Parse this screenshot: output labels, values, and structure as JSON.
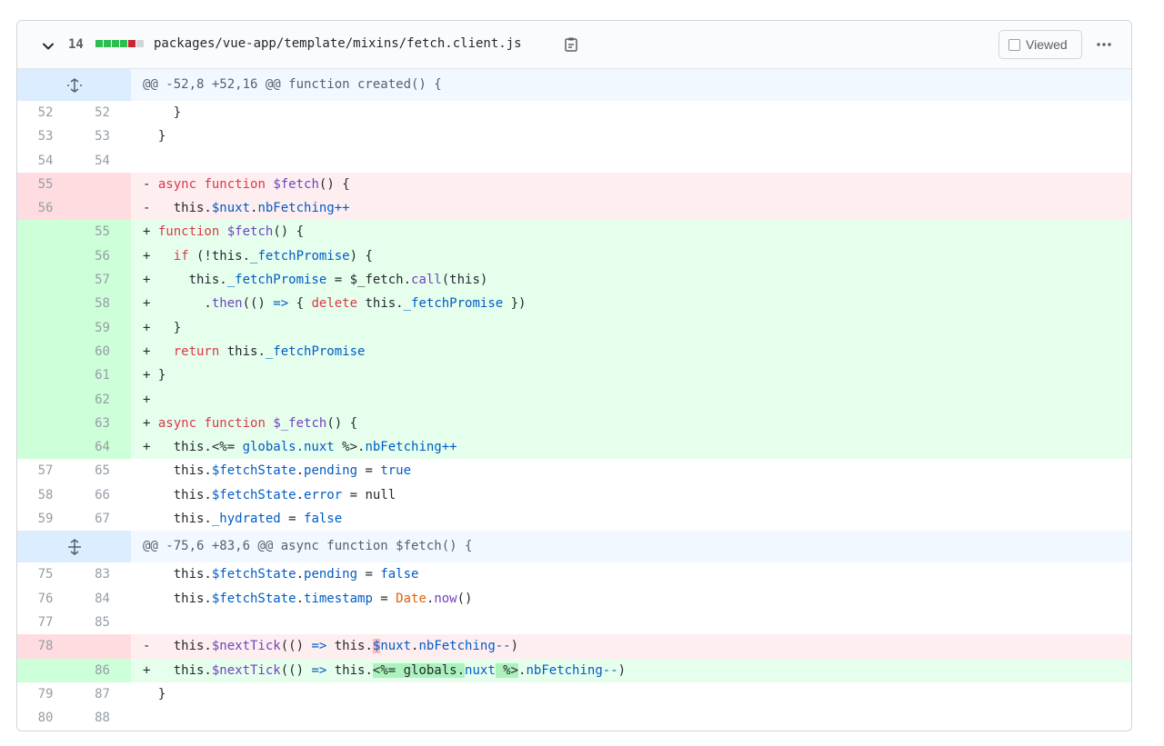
{
  "file": {
    "changes": "14",
    "path": "packages/vue-app/template/mixins/fetch.client.js",
    "viewed_label": "Viewed",
    "bar_colors": [
      "#2cbe4e",
      "#2cbe4e",
      "#2cbe4e",
      "#2cbe4e",
      "#cb2431",
      "#d1d5da"
    ]
  },
  "hunks": [
    {
      "header": "@@ -52,8 +52,16 @@ function created() {"
    },
    {
      "header": "@@ -75,6 +83,6 @@ async function $fetch() {"
    }
  ],
  "line_numbers": {
    "r1": [
      "52",
      "52"
    ],
    "r2": [
      "53",
      "53"
    ],
    "r3": [
      "54",
      "54"
    ],
    "r4": [
      "55",
      ""
    ],
    "r5": [
      "56",
      ""
    ],
    "r6": [
      "",
      "55"
    ],
    "r7": [
      "",
      "56"
    ],
    "r8": [
      "",
      "57"
    ],
    "r9": [
      "",
      "58"
    ],
    "r10": [
      "",
      "59"
    ],
    "r11": [
      "",
      "60"
    ],
    "r12": [
      "",
      "61"
    ],
    "r13": [
      "",
      "62"
    ],
    "r14": [
      "",
      "63"
    ],
    "r15": [
      "",
      "64"
    ],
    "r16": [
      "57",
      "65"
    ],
    "r17": [
      "58",
      "66"
    ],
    "r18": [
      "59",
      "67"
    ],
    "r19": [
      "75",
      "83"
    ],
    "r20": [
      "76",
      "84"
    ],
    "r21": [
      "77",
      "85"
    ],
    "r22": [
      "78",
      ""
    ],
    "r23": [
      "",
      "86"
    ],
    "r24": [
      "79",
      "87"
    ],
    "r25": [
      "80",
      "88"
    ]
  },
  "code": {
    "r1": [
      "    }"
    ],
    "r2": [
      "  }"
    ],
    "r3": [
      ""
    ],
    "r4": [
      "- ",
      "async",
      " ",
      "function",
      " ",
      "$fetch",
      "() {"
    ],
    "r5": [
      "-   this.",
      "$nuxt",
      ".",
      "nbFetching++"
    ],
    "r6": [
      "+ ",
      "function",
      " ",
      "$fetch",
      "() {"
    ],
    "r7": [
      "+   ",
      "if",
      " (!this.",
      "_fetchPromise",
      ") {"
    ],
    "r8": [
      "+     this.",
      "_fetchPromise",
      " = $_fetch.",
      "call",
      "(this)"
    ],
    "r9": [
      "+       .",
      "then",
      "(() ",
      "=>",
      " { ",
      "delete",
      " this.",
      "_fetchPromise",
      " })"
    ],
    "r10": [
      "+   }"
    ],
    "r11": [
      "+   ",
      "return",
      " this.",
      "_fetchPromise"
    ],
    "r12": [
      "+ }"
    ],
    "r13": [
      "+"
    ],
    "r14": [
      "+ ",
      "async",
      " ",
      "function",
      " ",
      "$_fetch",
      "() {"
    ],
    "r15": [
      "+   this.<%= ",
      "globals.nuxt",
      " %>.",
      "nbFetching++"
    ],
    "r16": [
      "    this.",
      "$fetchState",
      ".",
      "pending",
      " = ",
      "true"
    ],
    "r17": [
      "    this.",
      "$fetchState",
      ".",
      "error",
      " = null"
    ],
    "r18": [
      "    this.",
      "_hydrated",
      " = ",
      "false"
    ],
    "r19": [
      "    this.",
      "$fetchState",
      ".",
      "pending",
      " = ",
      "false"
    ],
    "r20": [
      "    this.",
      "$fetchState",
      ".",
      "timestamp",
      " = ",
      "Date",
      ".",
      "now",
      "()"
    ],
    "r21": [
      ""
    ],
    "r22": [
      "-   this.",
      "$nextTick",
      "(() ",
      "=>",
      " this.",
      "$",
      "nuxt",
      ".",
      "nbFetching--",
      ")"
    ],
    "r23": [
      "+   this.",
      "$nextTick",
      "(() ",
      "=>",
      " this.",
      "<%= globals.",
      "nuxt",
      " %>",
      ".",
      "nbFetching--",
      ")"
    ],
    "r24": [
      "  }"
    ],
    "r25": [
      ""
    ]
  }
}
